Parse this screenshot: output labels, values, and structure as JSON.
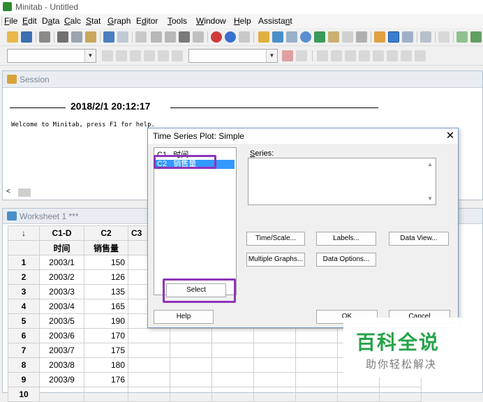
{
  "window": {
    "title": "Minitab - Untitled"
  },
  "menu": [
    {
      "label": "File",
      "u": "F",
      "rest": "ile"
    },
    {
      "label": "Edit",
      "u": "E",
      "rest": "dit"
    },
    {
      "label": "Data",
      "u": "a",
      "pre": "D",
      "rest": "ta"
    },
    {
      "label": "Calc",
      "u": "C",
      "rest": "alc"
    },
    {
      "label": "Stat",
      "u": "S",
      "rest": "tat"
    },
    {
      "label": "Graph",
      "u": "G",
      "rest": "raph"
    },
    {
      "label": "Editor",
      "u": "d",
      "pre": "E",
      "rest": "itor"
    },
    {
      "label": "Tools",
      "u": "T",
      "rest": "ools"
    },
    {
      "label": "Window",
      "u": "W",
      "rest": "indow"
    },
    {
      "label": "Help",
      "u": "H",
      "rest": "elp"
    },
    {
      "label": "Assistant",
      "u": "n",
      "pre": "Assista",
      "rest": "t"
    }
  ],
  "session": {
    "title": "Session",
    "datetime": "2018/2/1 20:12:17",
    "welcome": "Welcome to Minitab, press F1 for help."
  },
  "worksheet": {
    "title": "Worksheet 1 ***",
    "col_headers": [
      "↓",
      "C1-D",
      "C2",
      "C3"
    ],
    "col_names": [
      "",
      "时间",
      "销售量"
    ],
    "partial_col": "0",
    "rows": [
      {
        "n": "1",
        "date": "2003/1",
        "value": "150"
      },
      {
        "n": "2",
        "date": "2003/2",
        "value": "126"
      },
      {
        "n": "3",
        "date": "2003/3",
        "value": "135"
      },
      {
        "n": "4",
        "date": "2003/4",
        "value": "165"
      },
      {
        "n": "5",
        "date": "2003/5",
        "value": "190"
      },
      {
        "n": "6",
        "date": "2003/6",
        "value": "170"
      },
      {
        "n": "7",
        "date": "2003/7",
        "value": "175"
      },
      {
        "n": "8",
        "date": "2003/8",
        "value": "180"
      },
      {
        "n": "9",
        "date": "2003/9",
        "value": "176"
      },
      {
        "n": "10",
        "date": "",
        "value": ""
      }
    ]
  },
  "dialog": {
    "title": "Time Series Plot: Simple",
    "close": "✕",
    "variables": [
      {
        "col": "C1",
        "name": "时间"
      },
      {
        "col": "C2",
        "name": "销售量"
      }
    ],
    "series_label": "Series:",
    "buttons": {
      "time_scale": "Time/Scale...",
      "labels": "Labels...",
      "data_view": "Data View...",
      "multiple_graphs": "Multiple Graphs...",
      "data_options": "Data Options...",
      "select": "Select",
      "help": "Help",
      "ok": "OK",
      "cancel": "Cancel"
    }
  },
  "watermark": {
    "main": "百科全说",
    "sub": "助你轻松解决"
  },
  "colors": {
    "highlight": "#8e35b8",
    "selection": "#3399ff",
    "watermark": "#27a34a"
  }
}
